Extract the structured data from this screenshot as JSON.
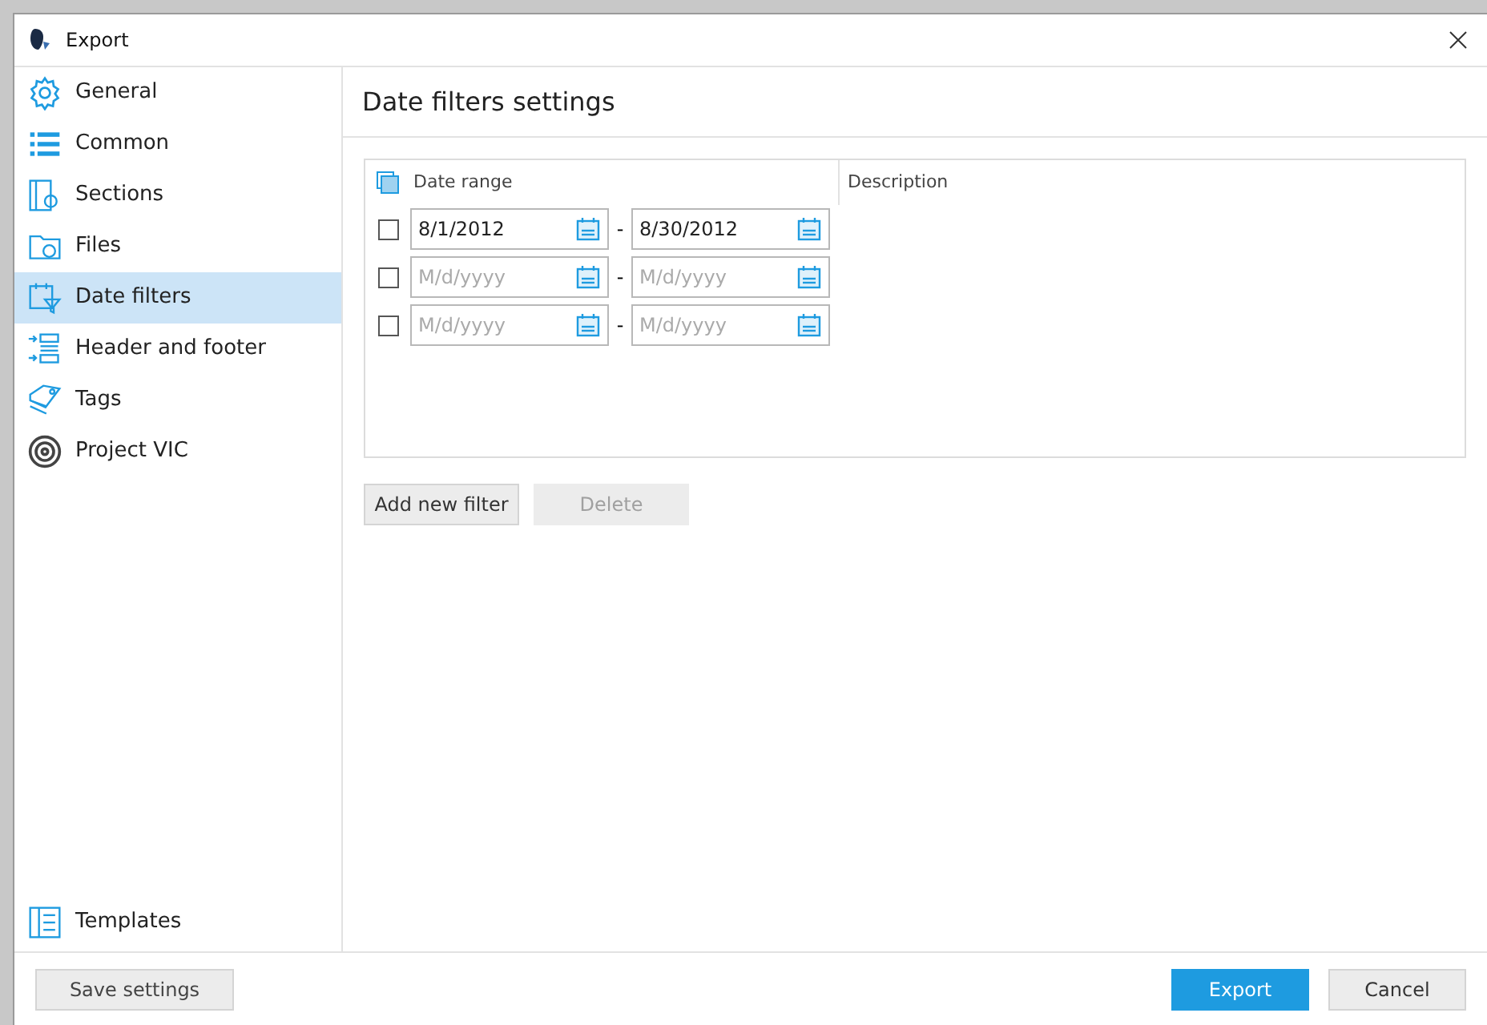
{
  "window": {
    "title": "Export"
  },
  "sidebar": {
    "items": [
      {
        "label": "General",
        "selected": false
      },
      {
        "label": "Common",
        "selected": false
      },
      {
        "label": "Sections",
        "selected": false
      },
      {
        "label": "Files",
        "selected": false
      },
      {
        "label": "Date filters",
        "selected": true
      },
      {
        "label": "Header and footer",
        "selected": false
      },
      {
        "label": "Tags",
        "selected": false
      },
      {
        "label": "Project VIC",
        "selected": false
      }
    ],
    "bottom_item": {
      "label": "Templates"
    }
  },
  "page_title": "Date filters settings",
  "table": {
    "columns": [
      "Date range",
      "Description"
    ],
    "rows": [
      {
        "checked": false,
        "from": {
          "value": "8/1/2012"
        },
        "separator": "-",
        "to": {
          "value": "8/30/2012"
        }
      },
      {
        "checked": false,
        "from": {
          "placeholder": "M/d/yyyy"
        },
        "separator": "-",
        "to": {
          "placeholder": "M/d/yyyy"
        }
      },
      {
        "checked": false,
        "from": {
          "placeholder": "M/d/yyyy"
        },
        "separator": "-",
        "to": {
          "placeholder": "M/d/yyyy"
        }
      }
    ]
  },
  "actions": [
    {
      "label": "Add new filter",
      "disabled": false
    },
    {
      "label": "Delete",
      "disabled": true
    }
  ],
  "footer": {
    "left": {
      "label": "Save settings"
    },
    "buttons": [
      {
        "label": "Export",
        "kind": "primary"
      },
      {
        "label": "Cancel",
        "kind": "secondary"
      }
    ]
  }
}
